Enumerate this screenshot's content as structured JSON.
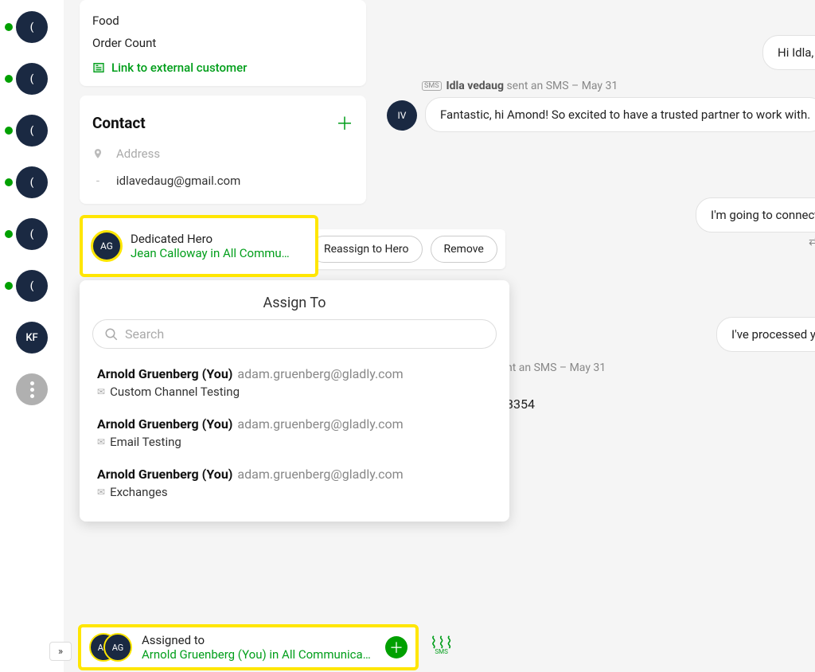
{
  "rail": {
    "avatars": [
      "(",
      "(",
      "(",
      "(",
      "(",
      "(",
      "KF"
    ]
  },
  "customer_card": {
    "row1": "Food",
    "row2": "Order Count",
    "link_label": "Link to external customer"
  },
  "contact": {
    "heading": "Contact",
    "address_placeholder": "Address",
    "email": "idlavedaug@gmail.com"
  },
  "dedicated_hero": {
    "avatar_initials": "AG",
    "title": "Dedicated Hero",
    "subtitle": "Jean Calloway in All Commu…"
  },
  "action_buttons": {
    "reassign": "Reassign to Hero",
    "remove": "Remove"
  },
  "assign_panel": {
    "title": "Assign To",
    "search_placeholder": "Search",
    "items": [
      {
        "name": "Arnold Gruenberg (You)",
        "email": "adam.gruenberg@gladly.com",
        "inbox": "Custom Channel Testing"
      },
      {
        "name": "Arnold Gruenberg (You)",
        "email": "adam.gruenberg@gladly.com",
        "inbox": "Email Testing"
      },
      {
        "name": "Arnold Gruenberg (You)",
        "email": "adam.gruenberg@gladly.com",
        "inbox": "Exchanges"
      }
    ]
  },
  "assigned_footer": {
    "avatar1": "AG",
    "avatar2": "AG",
    "title": "Assigned to",
    "subtitle": "Arnold Gruenberg (You) in All Communica…"
  },
  "sms_label": "SMS",
  "convo": {
    "msg1": "Hi Idla, N",
    "event1_prefix": "Idla vedaug",
    "event1_suffix": " sent an SMS – May 31",
    "iv_initials": "IV",
    "msg2": "Fantastic, hi Amond! So excited to have a trusted partner to work with.",
    "msg3": "I'm going to connect y",
    "msg4": "I've processed y",
    "event2": "nt an SMS – May 31",
    "trailing_number": "3354"
  }
}
